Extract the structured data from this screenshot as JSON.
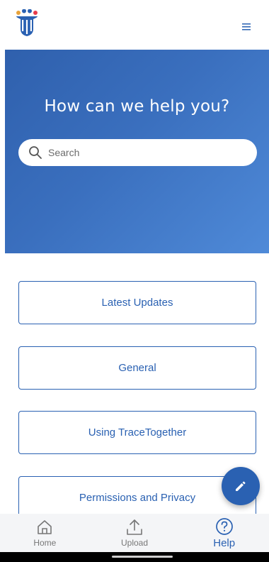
{
  "header": {
    "logo_icon": "tracetogether-logo-icon",
    "menu_icon": "hamburger-menu-icon"
  },
  "hero": {
    "title": "How can we help you?",
    "search": {
      "placeholder": "Search",
      "value": ""
    }
  },
  "categories": [
    {
      "label": "Latest Updates"
    },
    {
      "label": "General"
    },
    {
      "label": "Using TraceTogether"
    },
    {
      "label": "Permissions and Privacy"
    }
  ],
  "fab": {
    "icon": "pencil-icon"
  },
  "bottom_nav": [
    {
      "label": "Home",
      "icon": "home-icon",
      "active": false
    },
    {
      "label": "Upload",
      "icon": "upload-icon",
      "active": false
    },
    {
      "label": "Help",
      "icon": "help-icon",
      "active": true
    }
  ],
  "colors": {
    "primary": "#2a61b2",
    "hero_start": "#2f60ad",
    "hero_end": "#4f8ad8",
    "nav_background": "#f4f5f7",
    "inactive": "#777777"
  }
}
